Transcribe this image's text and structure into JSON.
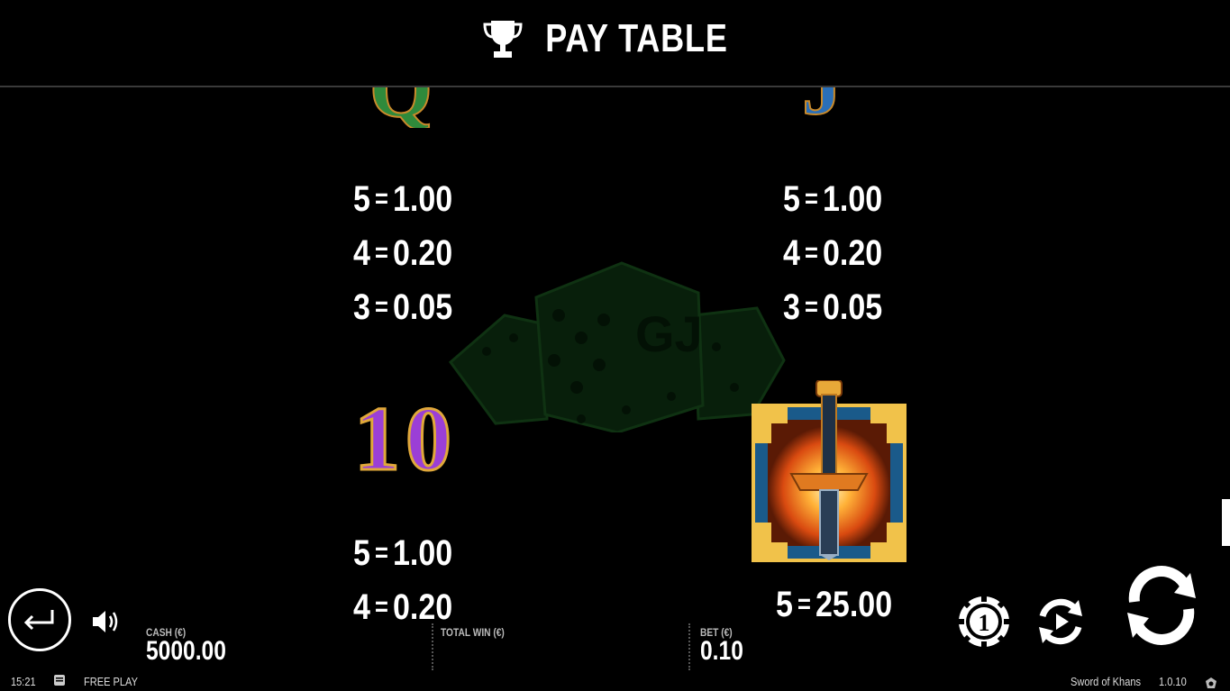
{
  "header": {
    "title": "PAY TABLE",
    "icon": "trophy-icon"
  },
  "paytable": [
    {
      "symbol": "Q",
      "symbol_color": "#2f8a3b",
      "payouts": [
        {
          "count": "5",
          "value": "1.00"
        },
        {
          "count": "4",
          "value": "0.20"
        },
        {
          "count": "3",
          "value": "0.05"
        }
      ]
    },
    {
      "symbol": "J",
      "symbol_color": "#2a6fb8",
      "payouts": [
        {
          "count": "5",
          "value": "1.00"
        },
        {
          "count": "4",
          "value": "0.20"
        },
        {
          "count": "3",
          "value": "0.05"
        }
      ]
    },
    {
      "symbol": "10",
      "symbol_color": "#9b3fd6",
      "payouts": [
        {
          "count": "5",
          "value": "1.00"
        },
        {
          "count": "4",
          "value": "0.20"
        }
      ]
    },
    {
      "symbol": "sword",
      "payouts": [
        {
          "count": "5",
          "value": "25.00"
        }
      ]
    }
  ],
  "bottom": {
    "cash_label": "CASH (€)",
    "cash_value": "5000.00",
    "total_win_label": "TOTAL WIN (€)",
    "bet_label": "BET (€)",
    "bet_value": "0.10"
  },
  "status_bar": {
    "time": "15:21",
    "mode": "FREE PLAY",
    "game_name": "Sword of Khans",
    "version": "1.0.10"
  }
}
